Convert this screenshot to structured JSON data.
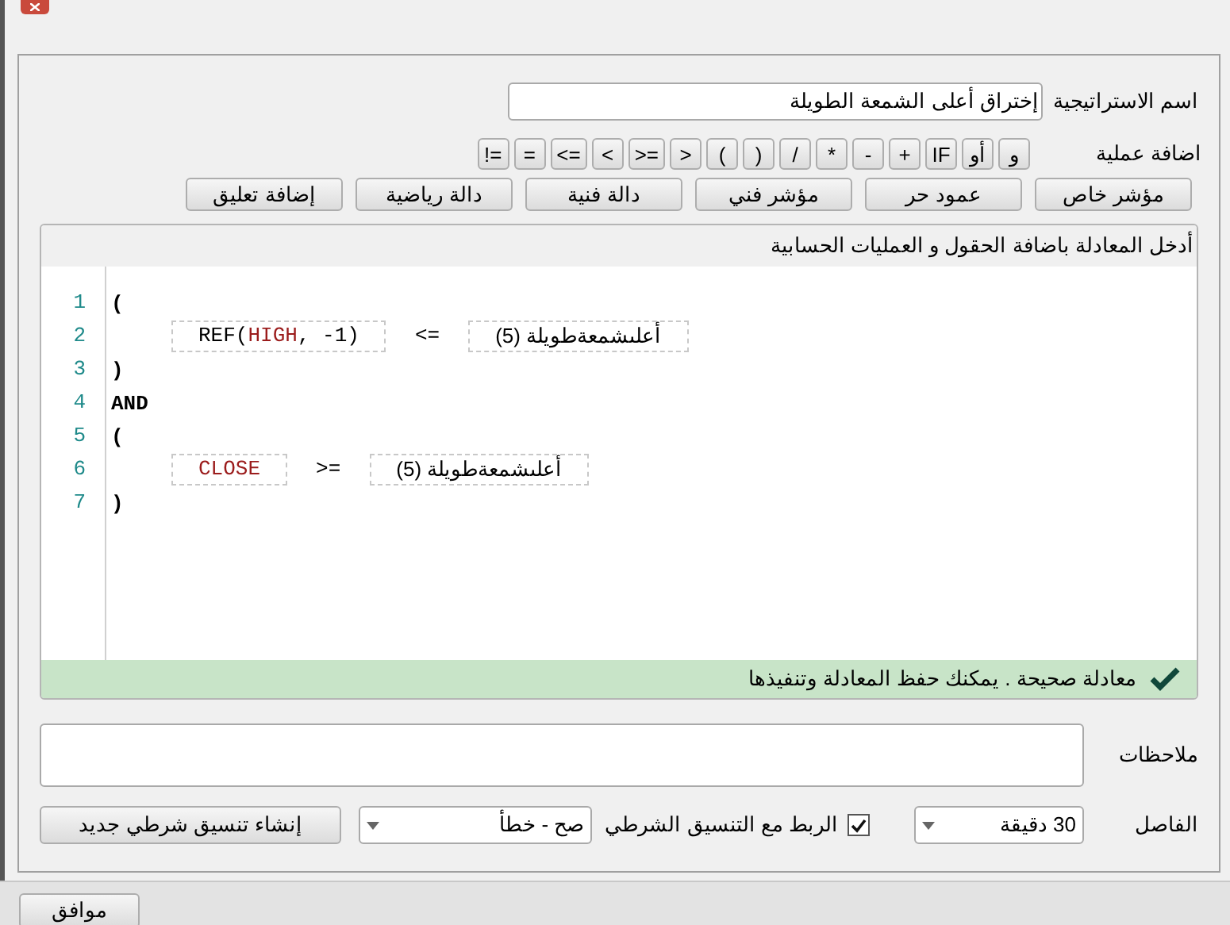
{
  "strategy": {
    "label": "اسم الاستراتيجية",
    "value": "إختراق أعلى الشمعة الطويلة"
  },
  "operations": {
    "label": "اضافة عملية",
    "operators": [
      "و",
      "أو",
      "IF",
      "+",
      "-",
      "*",
      "/",
      ")",
      "(",
      ">",
      ">=",
      "<",
      "<=",
      "=",
      "!="
    ],
    "buttons": [
      "مؤشر خاص",
      "عمود حر",
      "مؤشر فني",
      "دالة فنية",
      "دالة رياضية",
      "إضافة تعليق"
    ]
  },
  "editor": {
    "title": "أدخل المعادلة باضافة الحقول و العمليات الحسابية",
    "lines": [
      {
        "number": "1",
        "kind": "text",
        "text": "("
      },
      {
        "number": "2",
        "kind": "condition",
        "left": {
          "prefix": "REF(",
          "field": "HIGH",
          "suffix": ", -1)"
        },
        "operator": "<=",
        "right": "أعلىشمعةطويلة (5)"
      },
      {
        "number": "3",
        "kind": "text",
        "text": ")"
      },
      {
        "number": "4",
        "kind": "text",
        "text": "AND"
      },
      {
        "number": "5",
        "kind": "text",
        "text": "("
      },
      {
        "number": "6",
        "kind": "condition",
        "left": {
          "field": "CLOSE"
        },
        "operator": ">=",
        "right": "أعلىشمعةطويلة (5)"
      },
      {
        "number": "7",
        "kind": "text",
        "text": ")"
      }
    ],
    "status": {
      "valid": true,
      "text": "معادلة صحيحة . يمكنك حفظ المعادلة وتنفيذها"
    }
  },
  "notes": {
    "label": "ملاحظات"
  },
  "interval": {
    "label": "الفاصل",
    "value": "30 دقيقة"
  },
  "link": {
    "label": "الربط مع التنسيق الشرطي",
    "checked": true
  },
  "condition_select": {
    "value": "صح - خطأ"
  },
  "create_button": "إنشاء تنسيق شرطي جديد",
  "ok_button": "موافق"
}
